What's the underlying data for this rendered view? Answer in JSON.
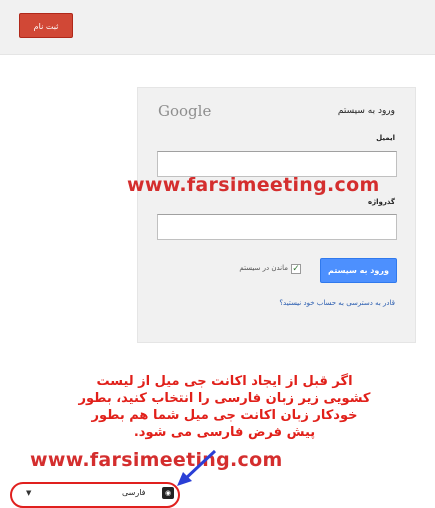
{
  "header": {
    "signup_label": "ثبت نام"
  },
  "login": {
    "logo": "Google",
    "title": "ورود به سیستم",
    "email_label": "ایمیل",
    "password_label": "گذرواژه",
    "submit_label": "ورود به سیستم",
    "stay_signed_in_label": "ماندن در سیستم",
    "stay_signed_in_checked": true,
    "help_link": "قادر به دسترسی به حساب خود نیستید؟"
  },
  "watermark": {
    "text_top": "www.farsimeeting.com",
    "text_bottom": "www.farsimeeting.com"
  },
  "note": {
    "lines": [
      "اگر قبل از ایجاد اکانت جی میل از لیست",
      "کشویی زیر زبان فارسی را انتخاب کنید، بطور",
      "خودکار زبان اکانت جی میل شما هم بطور",
      "پیش فرض فارسی می شود."
    ]
  },
  "language": {
    "selected": "فارسی",
    "icon": "speech-bubble-icon",
    "caret_icon": "caret-down-icon"
  },
  "colors": {
    "signup_red": "#d14836",
    "signin_blue": "#4d90fe",
    "annotation_red": "#d42e2e",
    "arrow_blue": "#2a3fd6"
  }
}
